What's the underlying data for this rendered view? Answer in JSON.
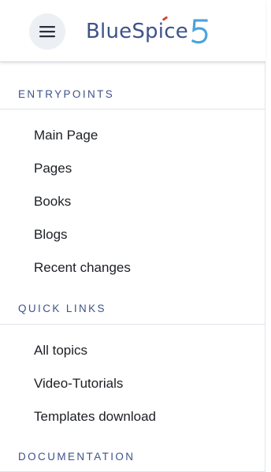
{
  "header": {
    "menu_icon": "hamburger-menu-icon",
    "logo": {
      "text_part1": "Blue",
      "text_part2": "Sp",
      "text_i": "i",
      "text_part3": "ce",
      "version": "5"
    },
    "brand_color": "#3e5389",
    "accent_color": "#d6452f",
    "version_color": "#4aa3df"
  },
  "sections": [
    {
      "title": "ENTRYPOINTS",
      "items": [
        "Main Page",
        "Pages",
        "Books",
        "Blogs",
        "Recent changes"
      ]
    },
    {
      "title": "QUICK LINKS",
      "items": [
        "All topics",
        "Video-Tutorials",
        "Templates download"
      ]
    },
    {
      "title": "DOCUMENTATION",
      "items": []
    }
  ]
}
